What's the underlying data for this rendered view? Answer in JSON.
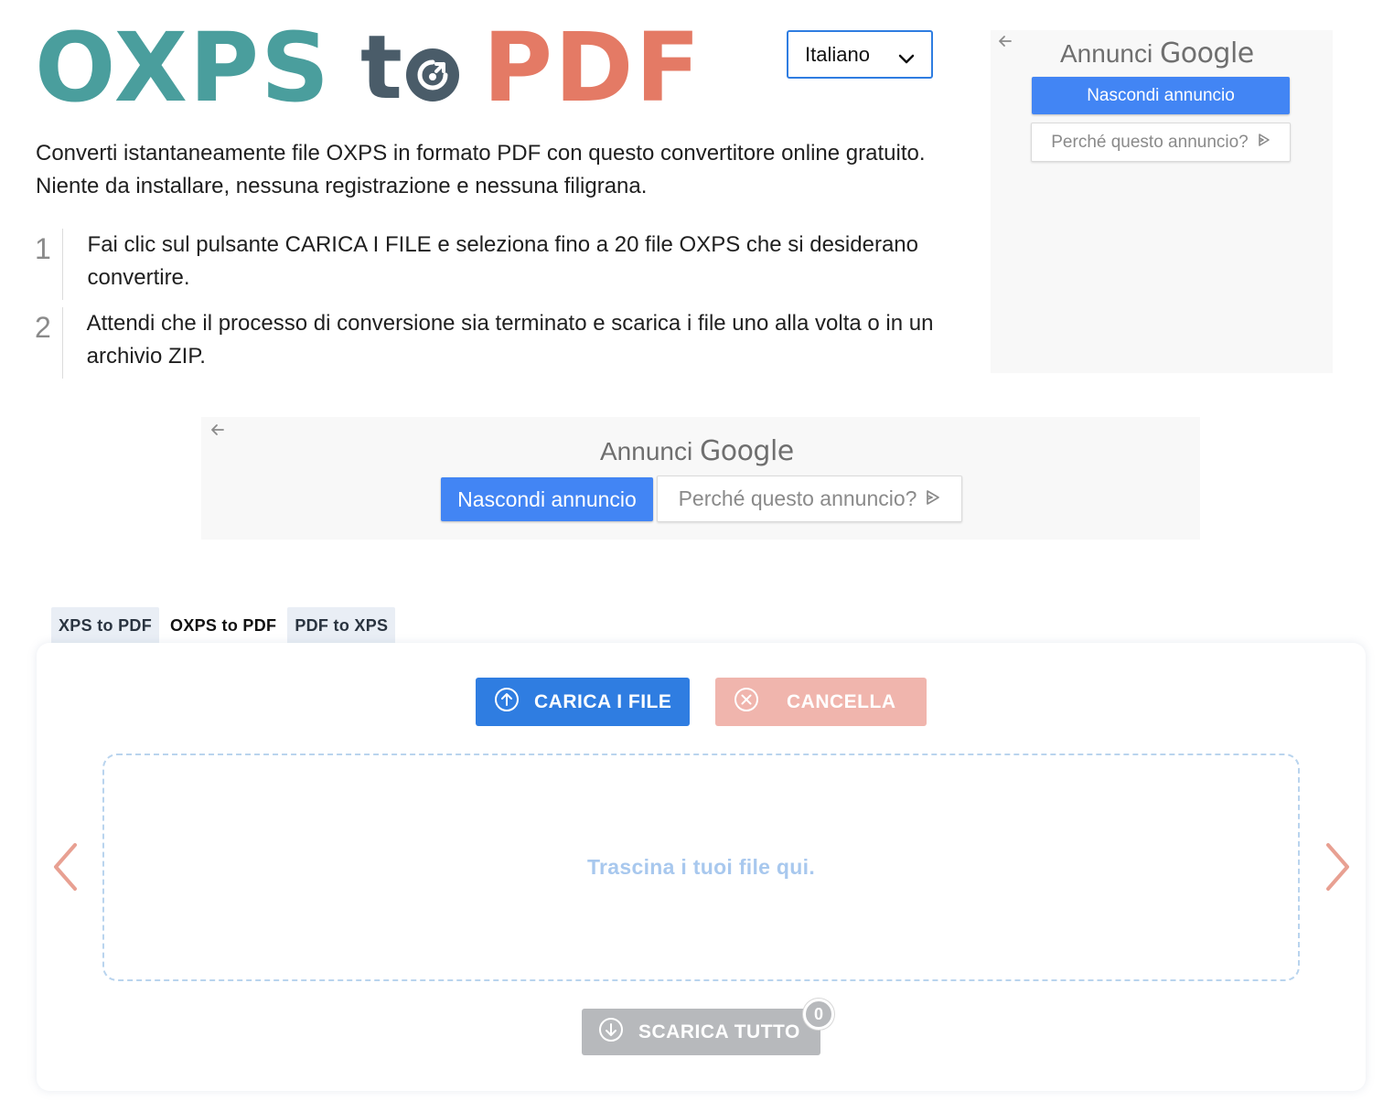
{
  "logo": {
    "part1": "OXPS",
    "part2_t": "t",
    "part3": "PDF"
  },
  "language": {
    "selected": "Italiano"
  },
  "intro": "Converti istantaneamente file OXPS in formato PDF con questo convertitore online gratuito. Niente da installare, nessuna registrazione e nessuna filigrana.",
  "steps": [
    {
      "num": "1",
      "text": "Fai clic sul pulsante CARICA I FILE e seleziona fino a 20 file OXPS che si desiderano convertire."
    },
    {
      "num": "2",
      "text": "Attendi che il processo di conversione sia terminato e scarica i file uno alla volta o in un archivio ZIP."
    }
  ],
  "ads": {
    "label": "Annunci",
    "brand": "Google",
    "hide": "Nascondi annuncio",
    "why": "Perché questo annuncio?"
  },
  "tabs": [
    {
      "label": "XPS to PDF",
      "active": false
    },
    {
      "label": "OXPS to PDF",
      "active": true
    },
    {
      "label": "PDF to XPS",
      "active": false
    }
  ],
  "converter": {
    "upload_label": "CARICA I FILE",
    "cancel_label": "CANCELLA",
    "dropzone_text": "Trascina i tuoi file qui.",
    "download_label": "SCARICA TUTTO",
    "file_count": "0"
  },
  "colors": {
    "teal": "#4a9e9d",
    "slate": "#4a5c69",
    "coral": "#e47a65",
    "primary_blue": "#2f7de1",
    "google_blue": "#4285f4",
    "cancel_pink": "#f0b5ad",
    "disabled_gray": "#b7b9bc"
  }
}
